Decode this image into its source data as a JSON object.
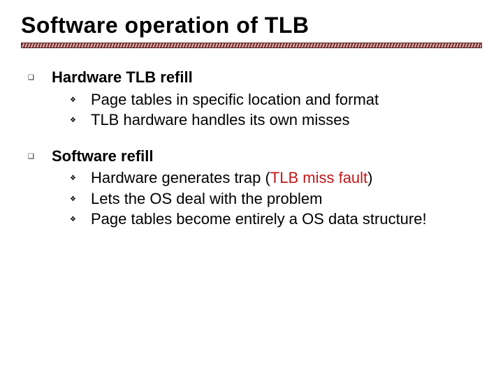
{
  "title": "Software operation of TLB",
  "sections": [
    {
      "heading": "Hardware TLB refill",
      "items": [
        {
          "text": "Page tables in specific location and format"
        },
        {
          "text": "TLB hardware handles its own misses"
        }
      ]
    },
    {
      "heading": "Software refill",
      "items": [
        {
          "prefix": "Hardware generates trap (",
          "accent": "TLB miss fault",
          "suffix": ")"
        },
        {
          "text": "Lets the OS deal with the problem"
        },
        {
          "text": "Page tables become entirely a OS data structure!"
        }
      ]
    }
  ]
}
